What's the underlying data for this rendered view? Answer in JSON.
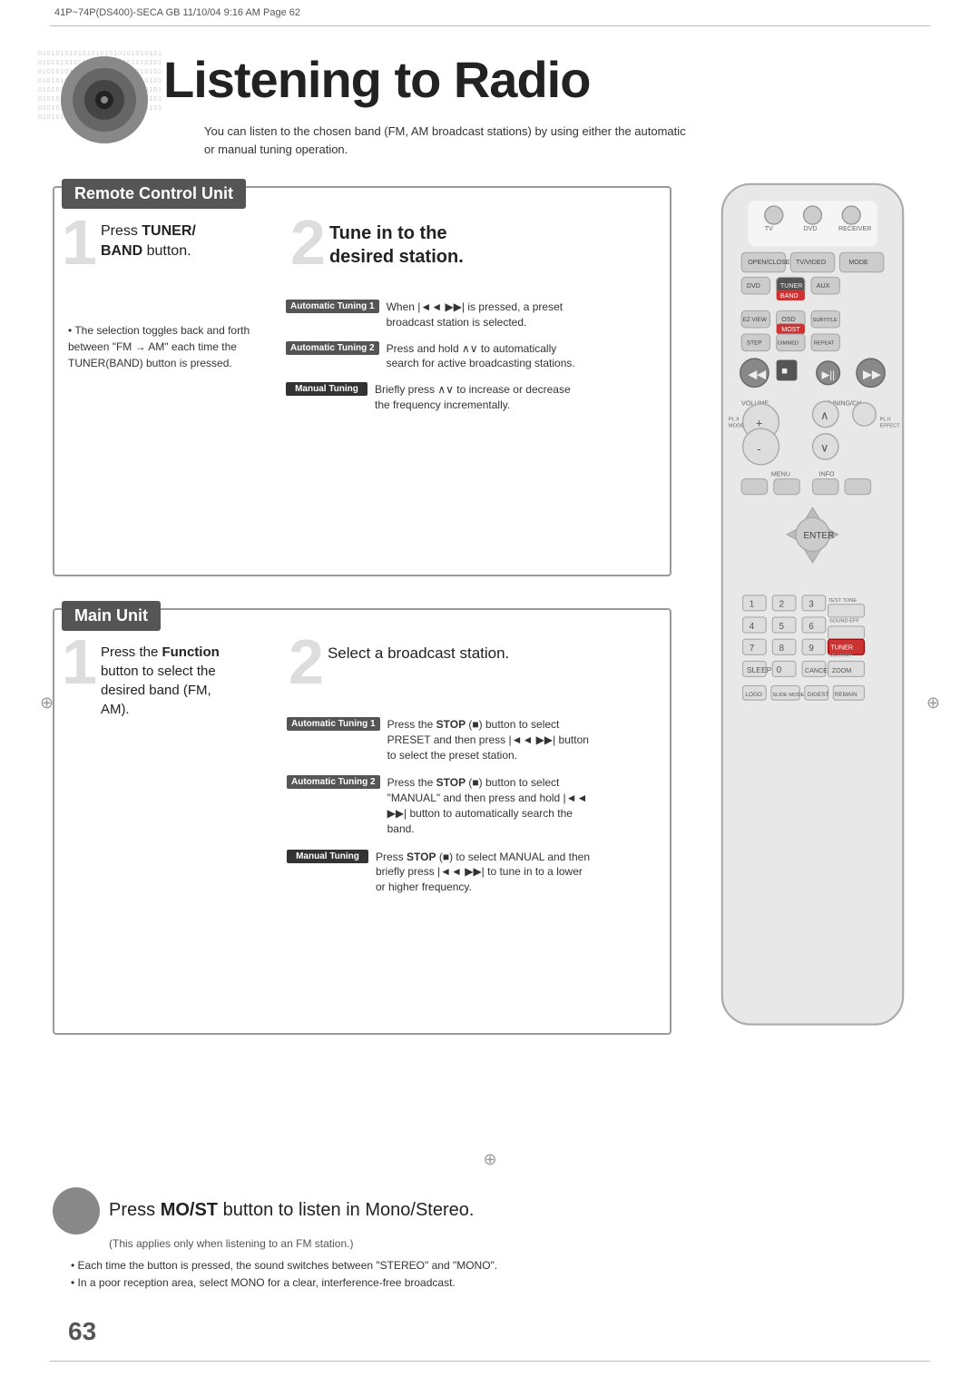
{
  "header": {
    "meta": "41P~74P(DS400)-SECA GB  11/10/04  9:16 AM  Page 62"
  },
  "title": "Listening to Radio",
  "intro": "You can listen to the chosen band (FM, AM broadcast stations) by using either the automatic or manual tuning operation.",
  "remote_section": {
    "label": "Remote Control Unit",
    "step1": {
      "number": "1",
      "text_line1": "Press TUNER/",
      "text_line2": "BAND button.",
      "bold_parts": [
        "TUNER/",
        "BAND"
      ],
      "bullet": "The selection toggles back and forth between \"FM → AM\" each time the TUNER(BAND) button is pressed."
    },
    "step2": {
      "number": "2",
      "title_line1": "Tune in to the",
      "title_line2": "desired station.",
      "tuning_rows": [
        {
          "badge": "Automatic Tuning 1",
          "desc": "When |◄◄ ►►| is pressed, a preset broadcast station is selected."
        },
        {
          "badge": "Automatic Tuning 2",
          "desc": "Press and hold ∧∨ to automatically search for active broadcasting stations."
        },
        {
          "badge": "Manual Tuning",
          "desc": "Briefly press ∧∨ to increase or decrease the frequency incrementally."
        }
      ]
    }
  },
  "main_section": {
    "label": "Main Unit",
    "step1": {
      "number": "1",
      "text": "Press the Function button to select the desired band (FM, AM).",
      "bold": "Function"
    },
    "step2": {
      "number": "2",
      "title": "Select a broadcast station.",
      "tuning_rows": [
        {
          "badge": "Automatic Tuning 1",
          "desc": "Press the STOP (■) button to select PRESET and then press |◄◄ ►►| button to select the preset station."
        },
        {
          "badge": "Automatic Tuning 2",
          "desc": "Press the STOP (■) button to select \"MANUAL\" and then press and hold |◄◄ ►►| button to automatically search the band."
        },
        {
          "badge": "Manual Tuning",
          "desc": "Press STOP (■) to select MANUAL and then briefly press |◄◄ ►►| to tune in to a lower or higher frequency."
        }
      ]
    }
  },
  "most_section": {
    "title_prefix": "Press ",
    "title_bold": "MO/ST",
    "title_suffix": " button to listen in Mono/Stereo.",
    "sub": "(This applies only when listening to an FM station.)",
    "bullets": [
      "Each time the button is pressed, the sound switches between \"STEREO\" and \"MONO\".",
      "In a poor reception area, select MONO for a clear, interference-free broadcast."
    ]
  },
  "page_number": "63",
  "binary_text": "010101010101010101010101010101010101010101010101010101010101010101010101010101010101010101010101010101010101010101010101010101010101010101010101010101010101010101010101010101010101010101010101010101010101"
}
